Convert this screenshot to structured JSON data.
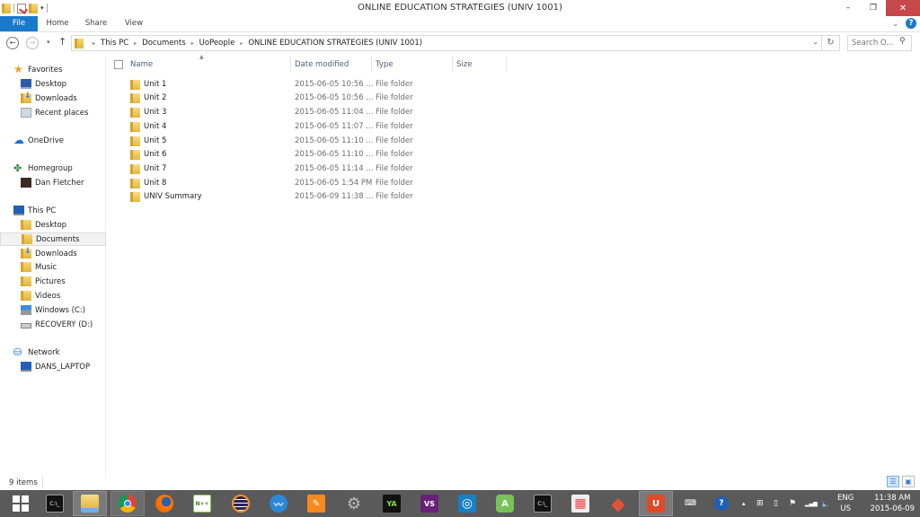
{
  "window": {
    "title": "ONLINE EDUCATION STRATEGIES (UNIV 1001)",
    "minimize_label": "–",
    "restore_label": "❐",
    "close_label": "✕"
  },
  "quick_access": {
    "dropdown": "▾"
  },
  "ribbon": {
    "tabs": [
      {
        "label": "File",
        "active": true
      },
      {
        "label": "Home"
      },
      {
        "label": "Share"
      },
      {
        "label": "View"
      }
    ],
    "expand_icon": "⌄",
    "help_label": "?"
  },
  "navigation": {
    "back": "←",
    "forward": "→",
    "recent_dropdown": "▾",
    "up": "↑",
    "breadcrumb": [
      "This PC",
      "Documents",
      "UoPeople",
      "ONLINE EDUCATION STRATEGIES (UNIV 1001)"
    ],
    "crumb_separator": "▸",
    "address_dropdown": "⌄",
    "refresh": "↻",
    "search_placeholder": "Search O...",
    "search_icon": "⚲"
  },
  "nav_pane": {
    "groups": [
      {
        "label": "Favorites",
        "icon": "star-icon",
        "items": [
          {
            "label": "Desktop",
            "icon": "desktop-icon"
          },
          {
            "label": "Downloads",
            "icon": "downloads-icon"
          },
          {
            "label": "Recent places",
            "icon": "recent-places-icon"
          }
        ]
      },
      {
        "label": "OneDrive",
        "icon": "onedrive-icon",
        "items": []
      },
      {
        "label": "Homegroup",
        "icon": "homegroup-icon",
        "items": [
          {
            "label": "Dan Fletcher",
            "icon": "user-icon"
          }
        ]
      },
      {
        "label": "This PC",
        "icon": "computer-icon",
        "items": [
          {
            "label": "Desktop",
            "icon": "desktop-folder-icon"
          },
          {
            "label": "Documents",
            "icon": "documents-folder-icon",
            "selected": true
          },
          {
            "label": "Downloads",
            "icon": "downloads-folder-icon"
          },
          {
            "label": "Music",
            "icon": "music-folder-icon"
          },
          {
            "label": "Pictures",
            "icon": "pictures-folder-icon"
          },
          {
            "label": "Videos",
            "icon": "videos-folder-icon"
          },
          {
            "label": "Windows (C:)",
            "icon": "windows-drive-icon"
          },
          {
            "label": "RECOVERY (D:)",
            "icon": "recovery-drive-icon"
          }
        ]
      },
      {
        "label": "Network",
        "icon": "network-icon",
        "items": [
          {
            "label": "DANS_LAPTOP",
            "icon": "network-computer-icon"
          }
        ]
      }
    ]
  },
  "file_list": {
    "columns": [
      "Name",
      "Date modified",
      "Type",
      "Size"
    ],
    "sort_indicator": "▲",
    "rows": [
      {
        "name": "Unit 1",
        "date": "2015-06-05 10:56 ...",
        "type": "File folder",
        "size": ""
      },
      {
        "name": "Unit 2",
        "date": "2015-06-05 10:56 ...",
        "type": "File folder",
        "size": ""
      },
      {
        "name": "Unit 3",
        "date": "2015-06-05 11:04 ...",
        "type": "File folder",
        "size": ""
      },
      {
        "name": "Unit 4",
        "date": "2015-06-05 11:07 ...",
        "type": "File folder",
        "size": ""
      },
      {
        "name": "Unit 5",
        "date": "2015-06-05 11:10 ...",
        "type": "File folder",
        "size": ""
      },
      {
        "name": "Unit 6",
        "date": "2015-06-05 11:10 ...",
        "type": "File folder",
        "size": ""
      },
      {
        "name": "Unit 7",
        "date": "2015-06-05 11:14 ...",
        "type": "File folder",
        "size": ""
      },
      {
        "name": "Unit 8",
        "date": "2015-06-05 1:54 PM",
        "type": "File folder",
        "size": ""
      },
      {
        "name": "UNIV Summary",
        "date": "2015-06-09 11:38 ...",
        "type": "File folder",
        "size": ""
      }
    ]
  },
  "status_bar": {
    "item_count": "9 items",
    "details_view": "☰",
    "large_icons_view": "▣"
  },
  "taskbar": {
    "apps": [
      {
        "name": "start",
        "label": ""
      },
      {
        "name": "command-prompt",
        "label": "C:\\_",
        "color": "#111111"
      },
      {
        "name": "file-explorer",
        "label": "",
        "color": "#f3d37a",
        "active": true
      },
      {
        "name": "chrome",
        "label": "",
        "color": "#dd4b39",
        "active2": true
      },
      {
        "name": "firefox",
        "label": "",
        "color": "#e66000"
      },
      {
        "name": "notepad-plus-plus",
        "label": "N++",
        "color": "#8bc34a"
      },
      {
        "name": "eclipse",
        "label": "",
        "color": "#2c2255"
      },
      {
        "name": "wunderlist",
        "label": "",
        "color": "#2b88d9"
      },
      {
        "name": "sublime-edit",
        "label": "✎",
        "color": "#f58a1f"
      },
      {
        "name": "settings-gear",
        "label": "⚙",
        "color": "#9a9a9a"
      },
      {
        "name": "vlc-camtasia",
        "label": "YA",
        "color": "#111111"
      },
      {
        "name": "visual-studio",
        "label": "VS",
        "color": "#68217a"
      },
      {
        "name": "network-monitor",
        "label": "◎",
        "color": "#1a7fc1"
      },
      {
        "name": "android-studio",
        "label": "A",
        "color": "#78c257"
      },
      {
        "name": "command-prompt-2",
        "label": "C:\\_",
        "color": "#111111"
      },
      {
        "name": "apps-grid",
        "label": "▦",
        "color": "#eeeeee"
      },
      {
        "name": "git",
        "label": "◆",
        "color": "#e2513a"
      },
      {
        "name": "app-red",
        "label": "U",
        "color": "#e04a2a",
        "active": true
      }
    ],
    "tray": {
      "keyboard": "⌨",
      "help_alert": "?",
      "show_hidden": "▴",
      "action_center": "⊞",
      "power": "▯",
      "flag": "⚑",
      "signal": "▂▄▆",
      "volume": "🔈",
      "language_top": "ENG",
      "language_bottom": "US",
      "time": "11:38 AM",
      "date": "2015-06-09"
    }
  }
}
